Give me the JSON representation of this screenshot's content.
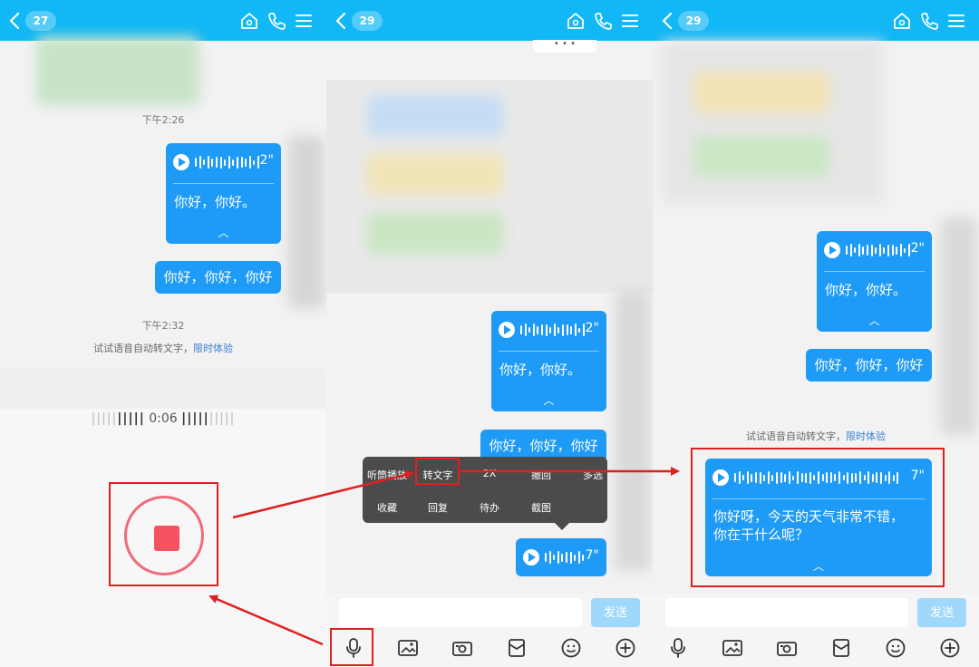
{
  "colors": {
    "accent": "#12b7f5",
    "bubble": "#1e9bf6",
    "highlight": "#e02020",
    "record": "#f5525f"
  },
  "panel1": {
    "unread_count": "27",
    "time1": "下午2:26",
    "voice_duration": "2\"",
    "transcript": "你好，你好。",
    "text_message": "你好，你好，你好",
    "time2": "下午2:32",
    "hint_text": "试试语音自动转文字，",
    "hint_link": "限时体验",
    "recording_time": "0:06"
  },
  "panel2": {
    "unread_count": "29",
    "voice_duration": "2\"",
    "transcript": "你好，你好。",
    "text_message": "你好，你好，你好",
    "voice2_duration": "7\"",
    "menu_row1": [
      "听筒播放",
      "转文字",
      "2X",
      "撤回",
      "多选"
    ],
    "menu_row2": [
      "收藏",
      "回复",
      "待办",
      "截图"
    ],
    "send_label": "发送"
  },
  "panel3": {
    "unread_count": "29",
    "voice_duration": "2\"",
    "transcript": "你好，你好。",
    "text_message": "你好，你好，你好",
    "hint_text": "试试语音自动转文字，",
    "hint_link": "限时体验",
    "voice2_duration": "7\"",
    "transcript2": "你好呀，今天的天气非常不错，你在干什么呢？",
    "send_label": "发送"
  },
  "header_icons": [
    "home-icon",
    "phone-icon",
    "menu-icon"
  ],
  "toolbar_icons": [
    "microphone-icon",
    "image-icon",
    "camera-icon",
    "red-packet-icon",
    "emoji-icon",
    "plus-icon"
  ]
}
